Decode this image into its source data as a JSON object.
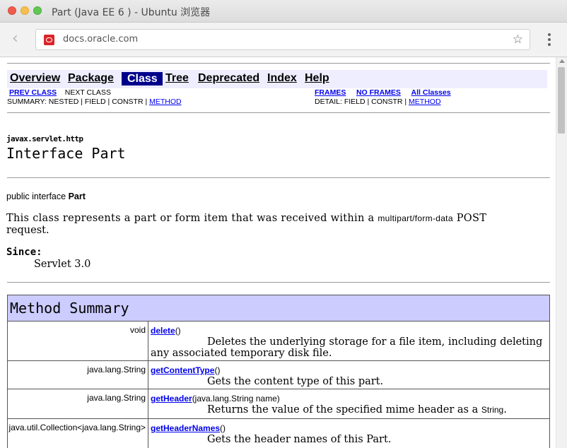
{
  "window": {
    "title": "Part (Java EE 6 ) - Ubuntu 浏览器"
  },
  "browser": {
    "url": "docs.oracle.com"
  },
  "nav": {
    "overview": "Overview",
    "package": "Package",
    "class": "Class",
    "tree": "Tree",
    "deprecated": "Deprecated",
    "index": "Index",
    "help": "Help",
    "prev_class": "PREV CLASS",
    "next_class": "NEXT CLASS",
    "frames": "FRAMES",
    "no_frames": "NO FRAMES",
    "all_classes": "All Classes",
    "summary_prefix": "SUMMARY: NESTED | FIELD | CONSTR |",
    "summary_method": "METHOD",
    "detail_prefix": "DETAIL: FIELD | CONSTR |",
    "detail_method": "METHOD"
  },
  "header": {
    "package": "javax.servlet.http",
    "title": "Interface Part"
  },
  "decl": {
    "prefix": "public interface",
    "name": "Part"
  },
  "description": {
    "line1_a": "This class represents a part or form item that was received within a",
    "code": "multipart/form-data",
    "line1_b": "POST",
    "line2": "request."
  },
  "since": {
    "label": "Since:",
    "value": "Servlet 3.0"
  },
  "method_summary": {
    "title": "Method Summary",
    "rows": [
      {
        "type": "void",
        "name": "delete",
        "sig": "()",
        "desc": "Deletes the underlying storage for a file item, including deleting any associated temporary disk file."
      },
      {
        "type": "java.lang.String",
        "name": "getContentType",
        "sig": "()",
        "desc": "Gets the content type of this part."
      },
      {
        "type": "java.lang.String",
        "name": "getHeader",
        "sig": "(java.lang.String name)",
        "desc": "Returns the value of the specified mime header as a",
        "desc_code": "String",
        "desc_end": "."
      },
      {
        "type": "java.util.Collection<java.lang.String>",
        "name": "getHeaderNames",
        "sig": "()",
        "desc": "Gets the header names of this Part."
      }
    ]
  }
}
